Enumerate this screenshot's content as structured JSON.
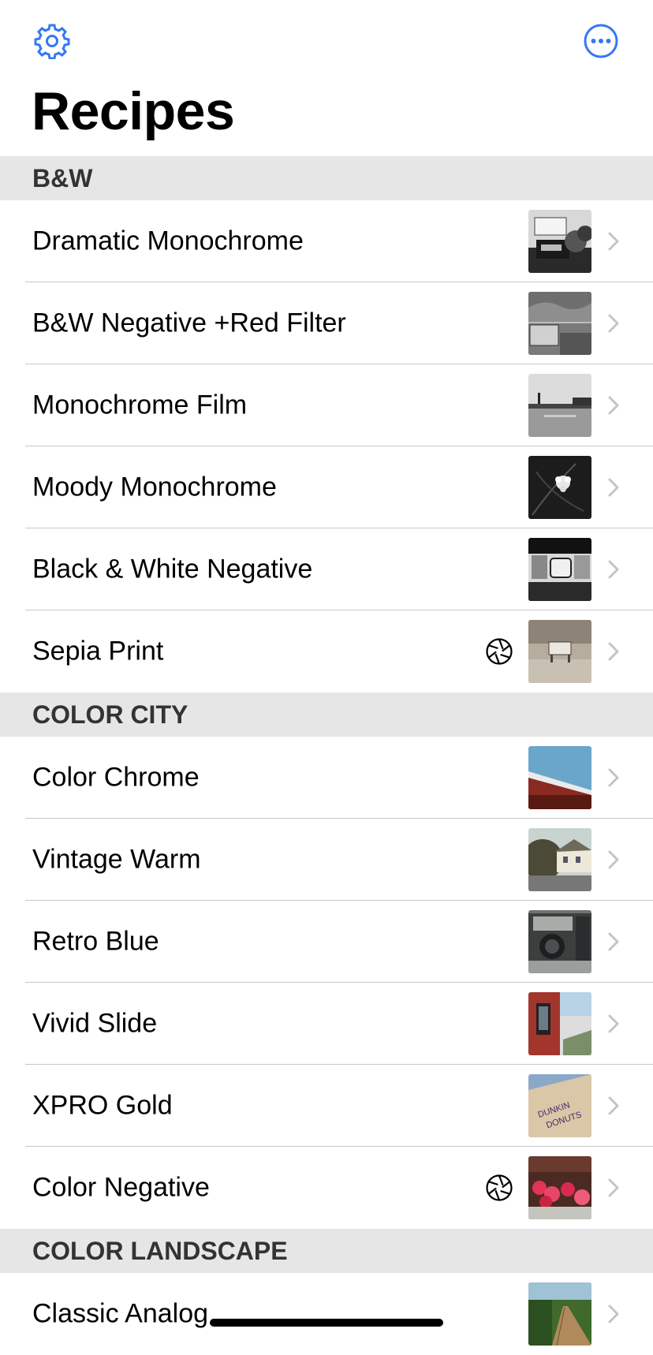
{
  "header": {
    "title": "Recipes",
    "settings_icon": "gear-icon",
    "more_icon": "ellipsis-circle-icon",
    "accent_color": "#3478f6"
  },
  "sections": [
    {
      "title": "B&W",
      "items": [
        {
          "label": "Dramatic Monochrome",
          "has_aperture": false,
          "thumb": "bw-truck"
        },
        {
          "label": "B&W Negative +Red Filter",
          "has_aperture": false,
          "thumb": "bw-sky"
        },
        {
          "label": "Monochrome Film",
          "has_aperture": false,
          "thumb": "bw-lot"
        },
        {
          "label": "Moody Monochrome",
          "has_aperture": false,
          "thumb": "bw-flower"
        },
        {
          "label": "Black & White Negative",
          "has_aperture": false,
          "thumb": "bw-sign"
        },
        {
          "label": "Sepia Print",
          "has_aperture": true,
          "thumb": "sepia"
        }
      ]
    },
    {
      "title": "COLOR CITY",
      "items": [
        {
          "label": "Color Chrome",
          "has_aperture": false,
          "thumb": "color-roof"
        },
        {
          "label": "Vintage Warm",
          "has_aperture": false,
          "thumb": "color-house"
        },
        {
          "label": "Retro Blue",
          "has_aperture": false,
          "thumb": "color-camera"
        },
        {
          "label": "Vivid Slide",
          "has_aperture": false,
          "thumb": "color-brick"
        },
        {
          "label": "XPRO Gold",
          "has_aperture": false,
          "thumb": "color-donuts"
        },
        {
          "label": "Color Negative",
          "has_aperture": true,
          "thumb": "color-flowers"
        }
      ]
    },
    {
      "title": "COLOR LANDSCAPE",
      "items": [
        {
          "label": "Classic Analog",
          "has_aperture": false,
          "thumb": "color-boardwalk"
        }
      ]
    }
  ]
}
